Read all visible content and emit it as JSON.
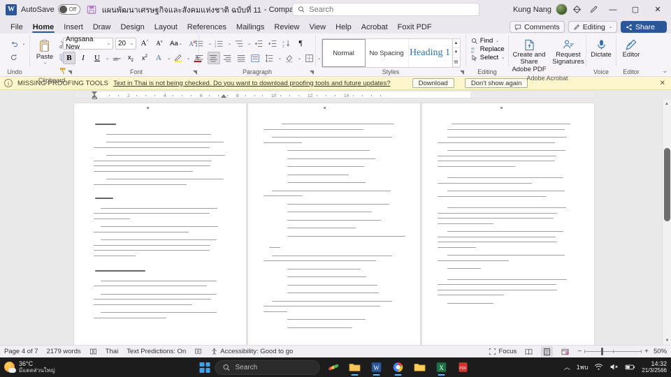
{
  "titlebar": {
    "app_icon": "word-icon",
    "autosave_label": "AutoSave",
    "autosave_state": "Off",
    "save_icon": "save-icon",
    "document_title": "แผนพัฒนาเศรษฐกิจและสังคมแห่งชาติ ฉบับที่ 11",
    "title_suffix": "-  Compatibility Mode • Saved to this PC",
    "title_chevron": "⌄",
    "search_placeholder": "Search",
    "search_value": "",
    "user_name": "Kung Nang",
    "ribbon_display_icon": "ribbon-display-icon",
    "minimize": "—",
    "restore": "▢",
    "close": "✕"
  },
  "tabs": [
    {
      "label": "File",
      "active": false
    },
    {
      "label": "Home",
      "active": true
    },
    {
      "label": "Insert",
      "active": false
    },
    {
      "label": "Draw",
      "active": false
    },
    {
      "label": "Design",
      "active": false
    },
    {
      "label": "Layout",
      "active": false
    },
    {
      "label": "References",
      "active": false
    },
    {
      "label": "Mailings",
      "active": false
    },
    {
      "label": "Review",
      "active": false
    },
    {
      "label": "View",
      "active": false
    },
    {
      "label": "Help",
      "active": false
    },
    {
      "label": "Acrobat",
      "active": false
    },
    {
      "label": "Foxit PDF",
      "active": false
    }
  ],
  "tabbar_right": {
    "comments_label": "Comments",
    "editing_label": "Editing",
    "editing_chevron": "⌄",
    "share_label": "Share",
    "share_chevron": "⌄"
  },
  "ribbon": {
    "groups": [
      {
        "name": "Undo",
        "label": "Undo"
      },
      {
        "name": "Clipboard",
        "label": "Clipboard",
        "paste_label": "Paste"
      },
      {
        "name": "Font",
        "label": "Font"
      },
      {
        "name": "Paragraph",
        "label": "Paragraph"
      },
      {
        "name": "Styles",
        "label": "Styles"
      },
      {
        "name": "Editing",
        "label": "Editing"
      },
      {
        "name": "Adobe Acrobat",
        "label": "Adobe Acrobat"
      },
      {
        "name": "Voice",
        "label": "Voice"
      },
      {
        "name": "Editor",
        "label": "Editor"
      }
    ],
    "font": {
      "family": "Angsana New",
      "size": "20",
      "grow_label": "A",
      "shrink_label": "A",
      "case_label": "Aa",
      "clear_label": "A",
      "bold": "B",
      "italic": "I",
      "underline": "U",
      "strike": "ab",
      "subscript": "x₂",
      "superscript": "x²",
      "text_effects": "A",
      "highlight": "A",
      "font_color": "A"
    },
    "styles": [
      {
        "label": "Normal",
        "selected": true
      },
      {
        "label": "No Spacing",
        "selected": false
      },
      {
        "label": "Heading 1",
        "selected": false
      }
    ],
    "editing": {
      "find_label": "Find",
      "replace_label": "Replace",
      "select_label": "Select"
    },
    "acrobat": {
      "create_share_label": "Create and Share\nAdobe PDF",
      "create_share_line1": "Create and Share",
      "create_share_line2": "Adobe PDF",
      "request_line1": "Request",
      "request_line2": "Signatures"
    },
    "voice": {
      "dictate_label": "Dictate"
    },
    "editor": {
      "editor_label": "Editor"
    },
    "collapse_chevron": "⌄"
  },
  "notice": {
    "icon": "info-icon",
    "title": "MISSING PROOFING TOOLS",
    "message": "Text in Thai is not being checked. Do you want to download proofing tools and future updates?",
    "download_label": "Download",
    "dismiss_label": "Don't show again",
    "close_label": "✕"
  },
  "ruler": {
    "ticks": [
      "2",
      "4",
      "6",
      "8",
      "10",
      "12",
      "14"
    ]
  },
  "document": {
    "pages": [
      {
        "page_label": "page-1",
        "blocks": [
          {
            "type": "heading",
            "indent": 8,
            "widths": [
              30
            ]
          },
          {
            "type": "list",
            "indent": 24,
            "widths": [
              150
            ]
          },
          {
            "type": "list",
            "indent": 24,
            "widths": [
              168,
              166
            ]
          },
          {
            "type": "list",
            "indent": 24,
            "widths": [
              170,
              169,
              167,
              142
            ]
          },
          {
            "type": "list",
            "indent": 24,
            "widths": [
              168,
              133
            ]
          },
          {
            "type": "gap"
          },
          {
            "type": "heading",
            "indent": 8,
            "widths": [
              26
            ]
          },
          {
            "type": "list",
            "indent": 16,
            "widths": [
              167,
              166,
              52
            ]
          },
          {
            "type": "list",
            "indent": 16,
            "widths": [
              168,
              136
            ]
          },
          {
            "type": "list",
            "indent": 16,
            "widths": [
              166,
              167,
              166,
              60
            ]
          },
          {
            "type": "gap"
          },
          {
            "type": "heading",
            "indent": 8,
            "widths": [
              72
            ]
          },
          {
            "type": "list",
            "indent": 16,
            "widths": [
              166,
              162
            ]
          },
          {
            "type": "list",
            "indent": 16,
            "widths": [
              166,
              168,
              141
            ]
          },
          {
            "type": "list",
            "indent": 16,
            "widths": [
              166,
              104
            ]
          }
        ]
      },
      {
        "page_label": "page-2",
        "blocks": [
          {
            "type": "list",
            "indent": 26,
            "widths": [
              161
            ]
          },
          {
            "type": "plain",
            "indent": 8,
            "widths": [
              143
            ]
          },
          {
            "type": "list",
            "indent": 12,
            "widths": [
              172,
              55
            ]
          },
          {
            "type": "sub",
            "indent": 34,
            "widths": [
              118
            ]
          },
          {
            "type": "sub",
            "indent": 34,
            "widths": [
              126
            ]
          },
          {
            "type": "sub",
            "indent": 34,
            "widths": [
              110
            ]
          },
          {
            "type": "sub",
            "indent": 34,
            "widths": [
              88
            ]
          },
          {
            "type": "sub",
            "indent": 34,
            "widths": [
              112
            ]
          },
          {
            "type": "list",
            "indent": 12,
            "widths": [
              170,
              56
            ]
          },
          {
            "type": "sub",
            "indent": 34,
            "widths": [
              146,
              100
            ]
          },
          {
            "type": "sub",
            "indent": 34,
            "widths": [
              121
            ]
          },
          {
            "type": "sub",
            "indent": 34,
            "widths": [
              134
            ]
          },
          {
            "type": "sub",
            "indent": 34,
            "widths": [
              98
            ]
          },
          {
            "type": "sub",
            "indent": 34,
            "widths": [
              169
            ]
          },
          {
            "type": "gap"
          },
          {
            "type": "plain",
            "indent": 8,
            "widths": [
              16
            ]
          },
          {
            "type": "list",
            "indent": 12,
            "widths": [
              172,
              161
            ]
          },
          {
            "type": "sub",
            "indent": 34,
            "widths": [
              105
            ]
          },
          {
            "type": "sub",
            "indent": 34,
            "widths": [
              113
            ]
          },
          {
            "type": "sub",
            "indent": 34,
            "widths": [
              129
            ]
          },
          {
            "type": "sub",
            "indent": 34,
            "widths": [
              131
            ]
          },
          {
            "type": "list",
            "indent": 12,
            "widths": [
              172,
              167
            ]
          },
          {
            "type": "plain",
            "indent": 8,
            "widths": [
              34
            ]
          },
          {
            "type": "sub",
            "indent": 34,
            "widths": [
              112
            ]
          },
          {
            "type": "sub",
            "indent": 34,
            "widths": [
              93
            ]
          }
        ]
      },
      {
        "page_label": "page-3",
        "blocks": [
          {
            "type": "sub",
            "indent": 20,
            "widths": [
              170
            ]
          },
          {
            "type": "sub",
            "indent": 14,
            "widths": [
              168
            ]
          },
          {
            "type": "sub",
            "indent": 14,
            "widths": [
              171,
              168
            ]
          },
          {
            "type": "sub",
            "indent": 14,
            "widths": [
              169,
              170,
              168,
              111
            ]
          },
          {
            "type": "gap"
          },
          {
            "type": "sub",
            "indent": 14,
            "widths": [
              166,
              135
            ]
          },
          {
            "type": "sub",
            "indent": 14,
            "widths": [
              168,
              156
            ]
          },
          {
            "type": "gap"
          },
          {
            "type": "sub",
            "indent": 14,
            "widths": [
              170,
              171,
              166,
              80
            ]
          },
          {
            "type": "sub",
            "indent": 14,
            "widths": [
              166,
              169,
              171,
              55
            ]
          },
          {
            "type": "sub",
            "indent": 14,
            "widths": [
              168,
              102
            ]
          },
          {
            "type": "sub",
            "indent": 14,
            "widths": [
              48
            ]
          },
          {
            "type": "gap"
          },
          {
            "type": "sub",
            "indent": 14,
            "widths": [
              171,
              170,
              171,
              95
            ]
          },
          {
            "type": "sub",
            "indent": 14,
            "widths": [
              66
            ]
          }
        ]
      }
    ]
  },
  "statusbar": {
    "page_label": "Page 4 of 7",
    "word_count": "2179 words",
    "proofing_icon": "proofing-icon",
    "language": "Thai",
    "text_predictions": "Text Predictions: On",
    "display_settings_icon": "display-settings-icon",
    "accessibility": "Accessibility: Good to go",
    "focus_label": "Focus",
    "view_read_icon": "read-mode-icon",
    "view_print_icon": "print-layout-icon",
    "view_web_icon": "web-layout-icon",
    "zoom_out": "−",
    "zoom_in": "+",
    "zoom_level": "50%"
  },
  "taskbar": {
    "weather_temp": "36°C",
    "weather_desc": "มีแดดส่วนใหญ่",
    "start_icon": "windows-start-icon",
    "search_placeholder": "Search",
    "apps": [
      {
        "name": "paint-icon"
      },
      {
        "name": "file-explorer-icon"
      },
      {
        "name": "word-icon"
      },
      {
        "name": "chrome-icon"
      },
      {
        "name": "folder-icon"
      },
      {
        "name": "excel-icon"
      },
      {
        "name": "pdf-icon"
      }
    ],
    "tray_chevron": "︿",
    "tray_onedrive": "1พบ",
    "wifi_icon": "wifi-icon",
    "volume_icon": "volume-muted-icon",
    "battery_icon": "battery-icon",
    "clock_time": "14:32",
    "clock_date": "21/3/2566"
  }
}
